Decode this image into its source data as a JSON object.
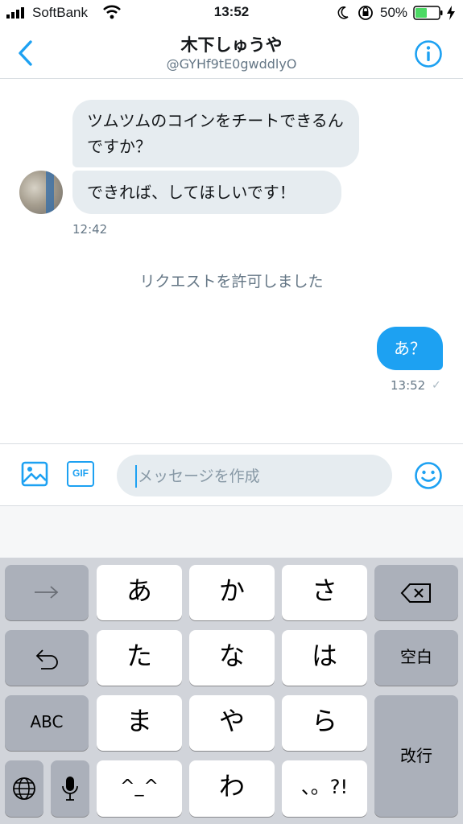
{
  "status_bar": {
    "carrier": "SoftBank",
    "time": "13:52",
    "battery": "50%"
  },
  "header": {
    "name": "木下しゅうや",
    "handle": "@GYHf9tE0gwddlyO"
  },
  "messages": {
    "incoming": [
      {
        "text": "ツムツムのコインをチートできるんですか？"
      },
      {
        "text": "できれば、してほしいです！"
      }
    ],
    "incoming_time": "12:42",
    "system": "リクエストを許可しました",
    "outgoing": {
      "text": "あ？",
      "time": "13:52"
    }
  },
  "composer": {
    "gif_label": "GIF",
    "placeholder": "メッセージを作成"
  },
  "keyboard": {
    "keys": {
      "a": "あ",
      "ka": "か",
      "sa": "さ",
      "ta": "た",
      "na": "な",
      "ha": "は",
      "ma": "ま",
      "ya": "や",
      "ra": "ら",
      "kaomoji": "^_^",
      "wa": "わ",
      "punct": "、。?!",
      "space": "空白",
      "abc": "ABC",
      "return": "改行"
    }
  },
  "colors": {
    "accent": "#1da1f2",
    "bubble_in": "#e6ecf0",
    "keyboard_bg": "#d1d4da",
    "dark_key": "#abb0ba"
  }
}
